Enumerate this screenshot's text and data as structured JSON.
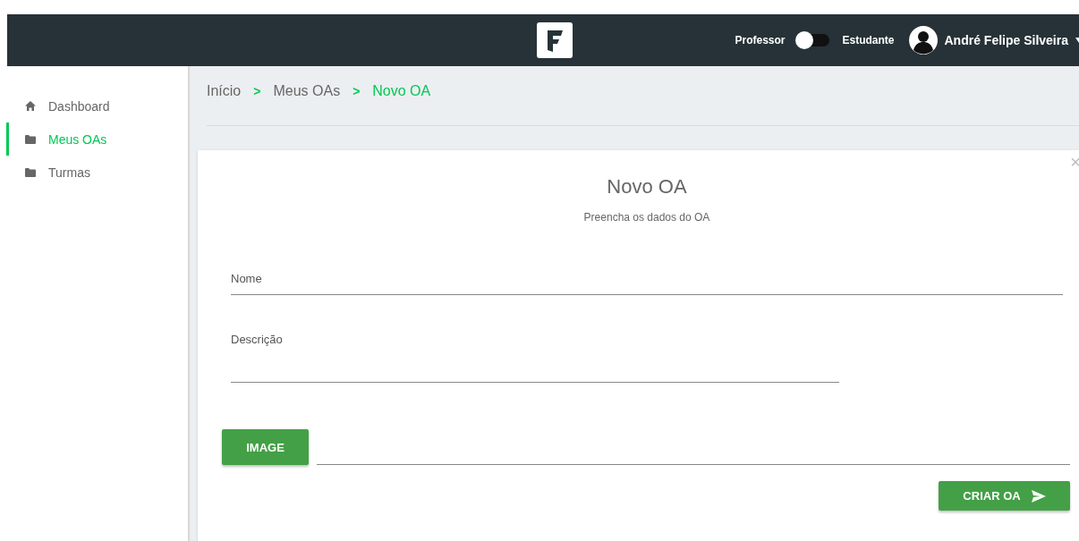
{
  "navbar": {
    "role_switch": {
      "left_label": "Professor",
      "right_label": "Estudante",
      "on": false
    },
    "user_name": "André Felipe Silveira"
  },
  "sidebar": {
    "items": [
      {
        "label": "Dashboard",
        "kind": "home",
        "selected": false
      },
      {
        "label": "Meus OAs",
        "kind": "folder",
        "selected": true
      },
      {
        "label": "Turmas",
        "kind": "folder",
        "selected": false
      }
    ]
  },
  "breadcrumb": [
    {
      "label": "Início",
      "current": false
    },
    {
      "label": "Meus OAs",
      "current": false
    },
    {
      "label": "Novo OA",
      "current": true
    }
  ],
  "breadcrumb_separator": ">",
  "dialog": {
    "title": "Novo OA",
    "subtitle": "Preencha os dados do OA",
    "close": "×",
    "fields": [
      {
        "placeholder": "Nome",
        "kind": "wide"
      },
      {
        "placeholder": "Descrição",
        "kind": "narrow"
      }
    ],
    "image_button": "IMAGE",
    "submit_button": "CRIAR OA"
  }
}
